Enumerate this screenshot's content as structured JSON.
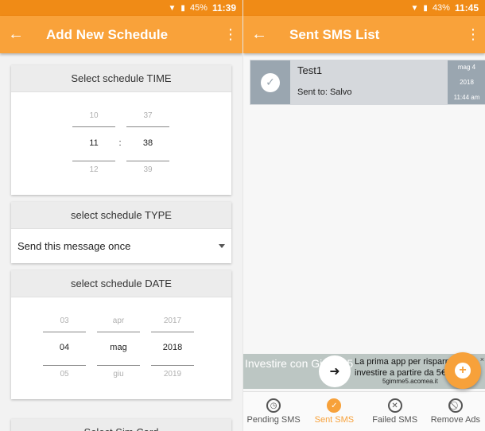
{
  "left": {
    "status": {
      "battery": "45%",
      "time": "11:39"
    },
    "appbar": {
      "back": "←",
      "title": "Add New Schedule",
      "more": "⋮"
    },
    "time_card": {
      "header": "Select schedule TIME",
      "hour": {
        "prev": "10",
        "current": "11",
        "next": "12"
      },
      "separator": ":",
      "minute": {
        "prev": "37",
        "current": "38",
        "next": "39"
      }
    },
    "type_card": {
      "header": "select schedule TYPE",
      "selected": "Send this message once"
    },
    "date_card": {
      "header": "select schedule DATE",
      "day": {
        "prev": "03",
        "current": "04",
        "next": "05"
      },
      "month": {
        "prev": "apr",
        "current": "mag",
        "next": "giu"
      },
      "year": {
        "prev": "2017",
        "current": "2018",
        "next": "2019"
      }
    },
    "sim_card": {
      "header": "Select Sim Card"
    }
  },
  "right": {
    "status": {
      "battery": "43%",
      "time": "11:45"
    },
    "appbar": {
      "back": "←",
      "title": "Sent SMS List",
      "more": "⋮"
    },
    "items": [
      {
        "title": "Test1",
        "sent_to": "Sent to: Salvo",
        "date_day": "mag 4",
        "date_year": "2018",
        "date_time": "11:44 am"
      }
    ],
    "ad": {
      "left_text": "Investire con Gimme5",
      "right_text": "La prima app per risparmiare e investire a partire da 5€",
      "url": "5gimme5.acomea.it",
      "close": "×"
    },
    "fab_icon": "+",
    "nav": [
      {
        "label": "Pending SMS",
        "icon": "clock-icon",
        "glyph": "◷"
      },
      {
        "label": "Sent SMS",
        "icon": "check-circle-icon",
        "glyph": "✓"
      },
      {
        "label": "Failed SMS",
        "icon": "cross-circle-icon",
        "glyph": "✕"
      },
      {
        "label": "Remove Ads",
        "icon": "block-icon",
        "glyph": "⃠"
      }
    ]
  },
  "colors": {
    "status": "#f08b16",
    "appbar": "#f9a23a",
    "accent": "#f7a13a",
    "item_bg": "#d5d8dc",
    "item_dark": "#9aa6b0"
  }
}
